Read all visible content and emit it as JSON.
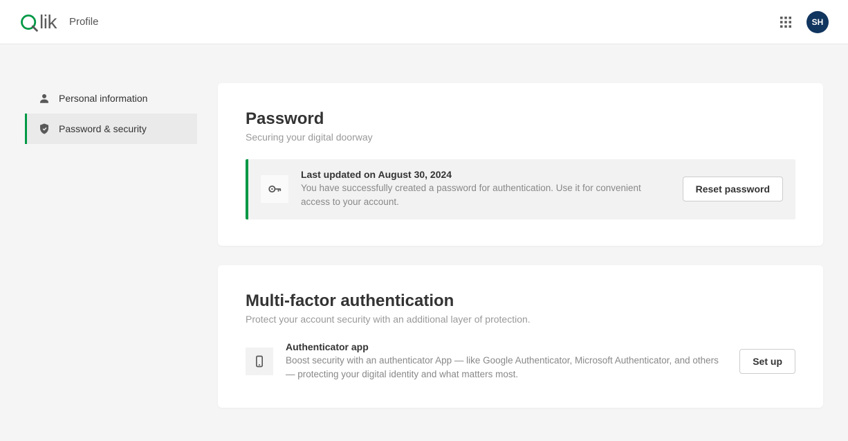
{
  "header": {
    "page_title": "Profile",
    "avatar_initials": "SH"
  },
  "sidebar": {
    "items": [
      {
        "label": "Personal information"
      },
      {
        "label": "Password & security"
      }
    ]
  },
  "password": {
    "title": "Password",
    "subtitle": "Securing your digital doorway",
    "banner_title": "Last updated on August 30, 2024",
    "banner_desc": "You have successfully created a password for authentication. Use it for convenient access to your account.",
    "reset_label": "Reset password"
  },
  "mfa": {
    "title": "Multi-factor authentication",
    "subtitle": "Protect your account security with an additional layer of protection.",
    "app_title": "Authenticator app",
    "app_desc": "Boost security with an authenticator App — like Google Authenticator, Microsoft Authenticator, and others — protecting your digital identity and what matters most.",
    "setup_label": "Set up"
  }
}
